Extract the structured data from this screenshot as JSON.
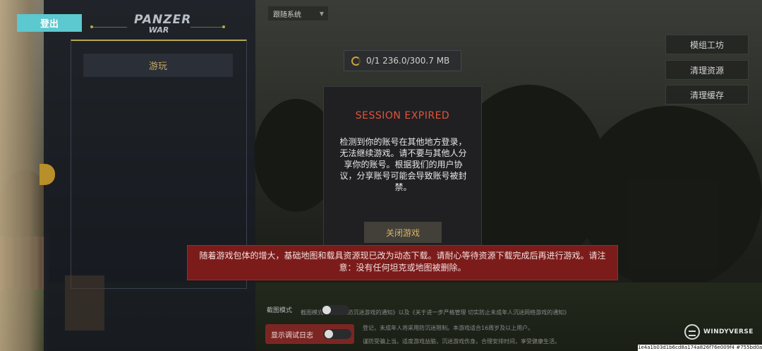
{
  "app": {
    "logout_label": "登出",
    "logo_line1": "PANZER",
    "logo_line2": "WAR",
    "play_label": "游玩",
    "follow_system_label": "跟随系统",
    "download_status": "0/1  236.0/300.7 MB"
  },
  "right_menu": {
    "items": [
      {
        "label": "模组工坊"
      },
      {
        "label": "清理资源"
      },
      {
        "label": "清理缓存"
      }
    ]
  },
  "dialog": {
    "title": "SESSION EXPIRED",
    "body": "检测到你的账号在其他地方登录，无法继续游戏。请不要与其他人分享你的账号。根据我们的用户协议，分享账号可能会导致账号被封禁。",
    "close_label": "关闭游戏"
  },
  "notice": {
    "text": "随着游戏包体的增大，基础地图和载具资源现已改为动态下载。请耐心等待资源下载完成后再进行游戏。请注意：没有任何坦克或地图被删除。"
  },
  "bottom": {
    "line1": "截图模式  未成年人防沉迷游戏的通知》以及《关于进一步严格管理 切实防止未成年人沉迷网络游戏的通知》",
    "line2": "登记，未成年人将采用防沉迷限制。本游戏适合16周岁及以上用户。",
    "line3": "谨防受骗上当。适度游戏益脑，沉迷游戏伤身。合理安排时间，享受健康生活。",
    "map_mode_label": "截图模式",
    "debug_label": "显示调试日志"
  },
  "brand": {
    "name": "WINDYVERSE",
    "hash": "1e4a1b03d1b6cd8a174a826f76e009f4 #755bd0ad"
  },
  "colors": {
    "logout_bg": "#5cc8cf",
    "accent_gold": "#b9a64c",
    "dialog_title": "#e0543a",
    "notice_bg": "#7c1c1a"
  },
  "icons": [
    "spinner-icon",
    "dropdown-arrow-icon",
    "windyverse-logo-icon"
  ]
}
